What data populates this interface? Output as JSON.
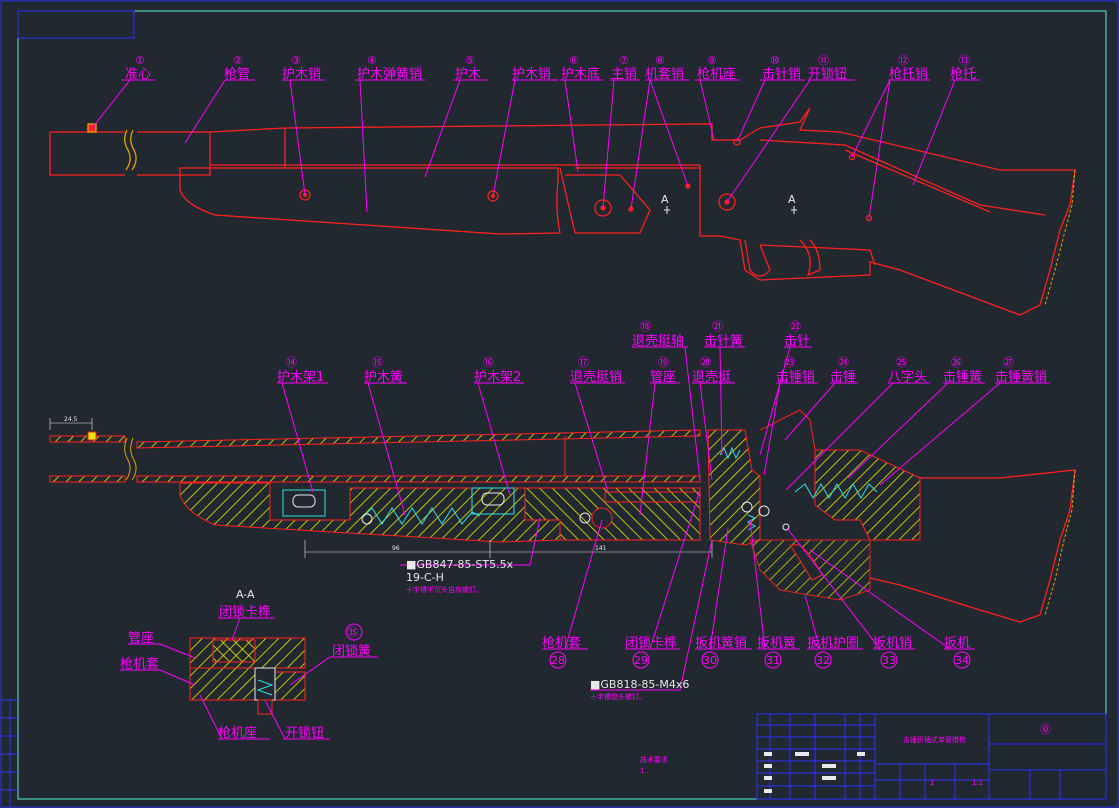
{
  "colors": {
    "background": "#212830",
    "frame": "#4ff0d0",
    "part": "#ff2020",
    "leader": "#ff00ff",
    "hatch": "#e8e800",
    "spring": "#30e0e0",
    "white": "#e8e8e8",
    "titleblock": "#3030ff"
  },
  "top_callouts": [
    {
      "num": "①",
      "label": "准心"
    },
    {
      "num": "②",
      "label": "枪管"
    },
    {
      "num": "③",
      "label": "护木销"
    },
    {
      "num": "④",
      "label": "护木弹簧销"
    },
    {
      "num": "⑤",
      "label": "护木"
    },
    {
      "num": "",
      "label": "护木销"
    },
    {
      "num": "⑥",
      "label": "护木底"
    },
    {
      "num": "⑦",
      "label": "主销"
    },
    {
      "num": "⑧",
      "label": "机套销"
    },
    {
      "num": "⑨",
      "label": "枪机座"
    },
    {
      "num": "⑩",
      "label": "击针销"
    },
    {
      "num": "⑪",
      "label": "开锁钮"
    },
    {
      "num": "⑫",
      "label": "枪托销"
    },
    {
      "num": "⑬",
      "label": "枪托"
    }
  ],
  "section_marks": [
    "A",
    "A"
  ],
  "mid_callouts": [
    {
      "num": "⑭",
      "label": "护木架1"
    },
    {
      "num": "⑮",
      "label": "护木簧"
    },
    {
      "num": "⑯",
      "label": "护木架2"
    },
    {
      "num": "⑰",
      "label": "退壳挺销"
    },
    {
      "num": "⑱",
      "label": "退壳挺轴"
    },
    {
      "num": "⑲",
      "label": "管座"
    },
    {
      "num": "⑳",
      "label": "退壳挺"
    },
    {
      "num": "㉑",
      "label": "击针簧"
    },
    {
      "num": "㉒",
      "label": "击针"
    },
    {
      "num": "㉓",
      "label": "击锤销"
    },
    {
      "num": "㉔",
      "label": "击锤"
    },
    {
      "num": "㉕",
      "label": "八字头"
    },
    {
      "num": "㉖",
      "label": "击锤簧"
    },
    {
      "num": "㉗",
      "label": "击锤簧销"
    }
  ],
  "bottom_callouts": [
    {
      "num": "28",
      "label": "枪机套"
    },
    {
      "num": "29",
      "label": "闭锁卡榫"
    },
    {
      "num": "30",
      "label": "扳机簧销"
    },
    {
      "num": "31",
      "label": "扳机簧"
    },
    {
      "num": "32",
      "label": "扳机护圈"
    },
    {
      "num": "33",
      "label": "扳机销"
    },
    {
      "num": "34",
      "label": "扳机"
    }
  ],
  "section_view": {
    "title": "A-A",
    "labels": {
      "lock_lug": "闭锁卡榫",
      "tube_seat": "管座",
      "receiver_sleeve": "枪机套",
      "receiver": "枪机座",
      "unlock_button": "开锁钮",
      "num35": "㉟",
      "lock_spring": "闭锁簧"
    }
  },
  "notes": {
    "screw1_line1": "■GB847-85-ST5.5x",
    "screw1_line2": "19-C-H",
    "screw1_line3": "十字槽半沉头自攻螺钉。",
    "screw2_line1": "■GB818-85-M4x6",
    "screw2_line2": "十字槽盘头螺钉。",
    "dim_top": "24.5",
    "dim_a": "96",
    "dim_b": "141",
    "tech_req_title": "技术要求",
    "tech_req_body": "1.."
  },
  "title_block": {
    "drawing_name": "击锤折插式单管猎枪",
    "sheet_mark": "⓪",
    "scale": "1:1",
    "qty": "1"
  }
}
